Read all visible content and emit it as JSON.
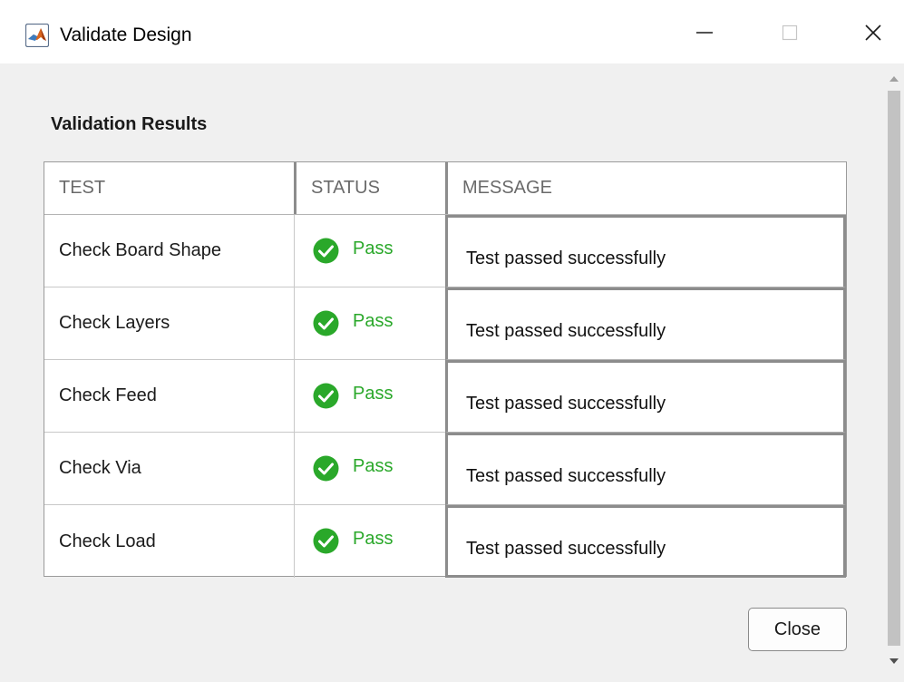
{
  "window": {
    "title": "Validate Design",
    "icon": "matlab-logo-icon",
    "controls": {
      "minimize": "minimize-icon",
      "maximize": "maximize-icon",
      "close": "close-icon"
    }
  },
  "section": {
    "title": "Validation Results"
  },
  "table": {
    "columns": [
      "TEST",
      "STATUS",
      "MESSAGE"
    ],
    "rows": [
      {
        "test": "Check Board Shape",
        "status": "Pass",
        "message": "Test passed successfully"
      },
      {
        "test": "Check Layers",
        "status": "Pass",
        "message": "Test passed successfully"
      },
      {
        "test": "Check Feed",
        "status": "Pass",
        "message": "Test passed successfully"
      },
      {
        "test": "Check Via",
        "status": "Pass",
        "message": "Test passed successfully"
      },
      {
        "test": "Check Load",
        "status": "Pass",
        "message": "Test passed successfully"
      }
    ],
    "status_icon": "check-circle-icon",
    "status_color": "#2aa82a"
  },
  "footer": {
    "close_label": "Close"
  }
}
